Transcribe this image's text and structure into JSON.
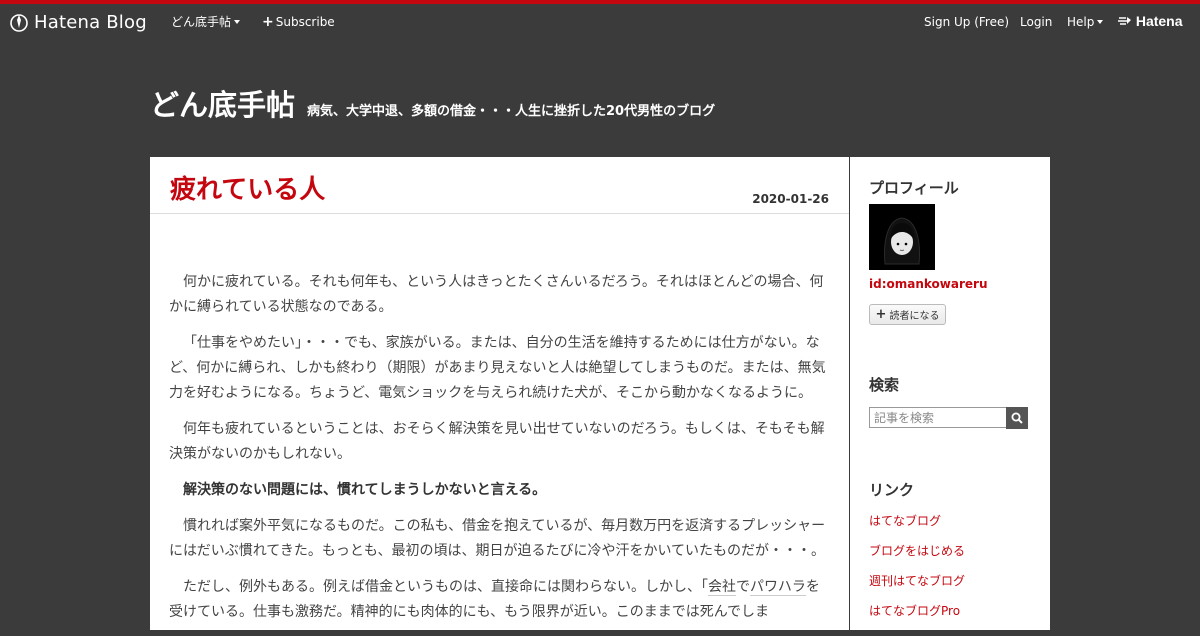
{
  "global_header": {
    "brand": "Hatena Blog",
    "blog_menu": "どん底手帖",
    "subscribe": "Subscribe",
    "signup": "Sign Up (Free)",
    "login": "Login",
    "help": "Help",
    "hatena": "Hatena"
  },
  "blog": {
    "title": "どん底手帖",
    "description": "病気、大学中退、多額の借金・・・人生に挫折した20代男性のブログ"
  },
  "entry": {
    "title": "疲れている人",
    "date": "2020-01-26",
    "paragraphs": [
      "何かに疲れている。それも何年も、という人はきっとたくさんいるだろう。それはほとんどの場合、何かに縛られている状態なのである。",
      "「仕事をやめたい」・・・でも、家族がいる。または、自分の生活を維持するためには仕方がない。など、何かに縛られ、しかも終わり（期限）があまり見えないと人は絶望してしまうものだ。または、無気力を好むようになる。ちょうど、電気ショックを与えられ続けた犬が、そこから動かなくなるように。",
      "何年も疲れているということは、おそらく解決策を見い出せていないのだろう。もしくは、そもそも解決策がないのかもしれない。",
      "解決策のない問題には、慣れてしまうしかないと言える。",
      "慣れれば案外平気になるものだ。この私も、借金を抱えているが、毎月数万円を返済するプレッシャーにはだいぶ慣れてきた。もっとも、最初の頃は、期日が迫るたびに冷や汗をかいていたものだが・・・。"
    ],
    "p6_a": "ただし、例外もある。例えば借金というものは、直接命には関わらない。しかし、「",
    "p6_kw1": "会社",
    "p6_b": "で",
    "p6_kw2": "パワハラ",
    "p6_c": "を受けている。仕事も激務だ。精神的にも肉体的にも、もう限界が近い。このままでは死んでしま"
  },
  "sidebar": {
    "profile_heading": "プロフィール",
    "user_id": "id:omankowareru",
    "reader_button": "読者になる",
    "search_heading": "検索",
    "search_placeholder": "記事を検索",
    "links_heading": "リンク",
    "links": [
      "はてなブログ",
      "ブログをはじめる",
      "週刊はてなブログ",
      "はてなブログPro"
    ]
  },
  "colors": {
    "accent": "#c4070f",
    "background": "#3b3b3b",
    "panel": "#ffffff"
  }
}
